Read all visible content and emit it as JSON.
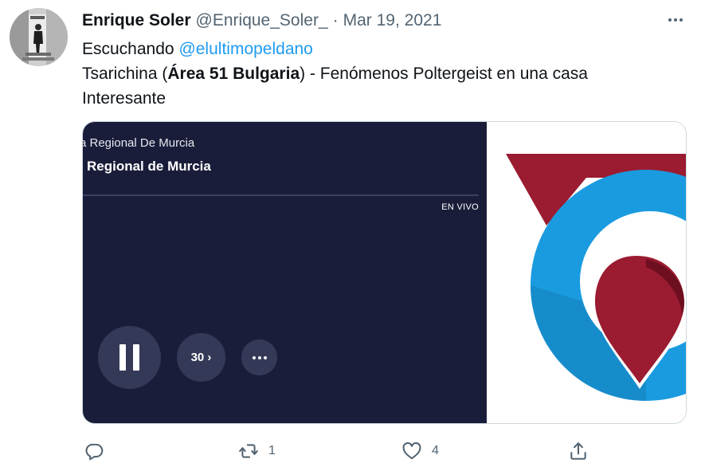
{
  "tweet": {
    "author_name": "Enrique Soler",
    "author_handle": "@Enrique_Soler_",
    "separator": "·",
    "date": "Mar 19, 2021",
    "text": {
      "line1_prefix": "Escuchando",
      "mention": "@elultimopeldano",
      "line2_before": "Tsarichina (",
      "line2_bold": "Área 51 Bulgaria",
      "line2_after": ") - Fenómenos Poltergeist en una casa",
      "line3": "Interesante"
    }
  },
  "player_card": {
    "show_subtitle": "a Regional De Murcia",
    "show_title": " Regional de Murcia",
    "live_label": "EN VIVO",
    "skip_label": "30 ›",
    "playback_state": "playing",
    "artwork_colors": {
      "red": "#9b1b30",
      "blue": "#1a9be0",
      "dark_red": "#6e0f20"
    }
  },
  "actions": {
    "reply_icon": "reply-icon",
    "retweet_icon": "retweet-icon",
    "retweet_count": "1",
    "like_icon": "heart-icon",
    "like_count": "4",
    "share_icon": "share-icon"
  },
  "colors": {
    "text_primary": "#0f1419",
    "text_secondary": "#536471",
    "link": "#1d9bf0",
    "player_bg": "#1a1d3a",
    "player_button": "#353958"
  }
}
